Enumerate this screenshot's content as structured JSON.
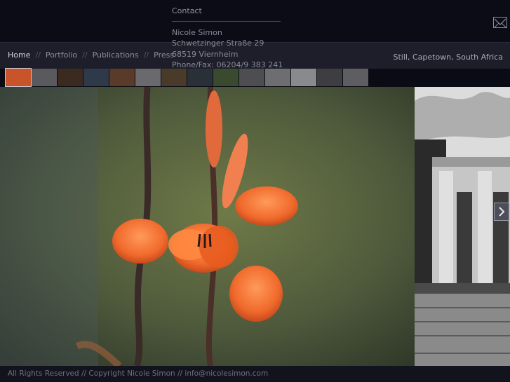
{
  "contact": {
    "title": "Contact",
    "name": "Nicole Simon",
    "street": "Schwetzinger Straße 29",
    "city": "68519 Viernheim",
    "phone": "Phone/Fax: 06204/9 383 241"
  },
  "nav": {
    "items": [
      "Home",
      "Portfolio",
      "Publications",
      "Press"
    ],
    "separator": "//"
  },
  "caption": "Still, Capetown, South Africa",
  "thumbnails": {
    "count": 14,
    "selected_index": 0,
    "colors": [
      "#c9542a",
      "#5a5a5e",
      "#3a2a20",
      "#2e3a4a",
      "#5a3a28",
      "#6a6a6e",
      "#4a3a2a",
      "#2a3038",
      "#3a4a2e",
      "#4e4e52",
      "#6e6e72",
      "#8a8a8e",
      "#3e3e42",
      "#5e5e62"
    ]
  },
  "icons": {
    "mail": "mail-icon",
    "next": "chevron-right-icon"
  },
  "footer": {
    "text": "All Rights Reserved // Copyright Nicole Simon // info@nicolesimon.com"
  }
}
